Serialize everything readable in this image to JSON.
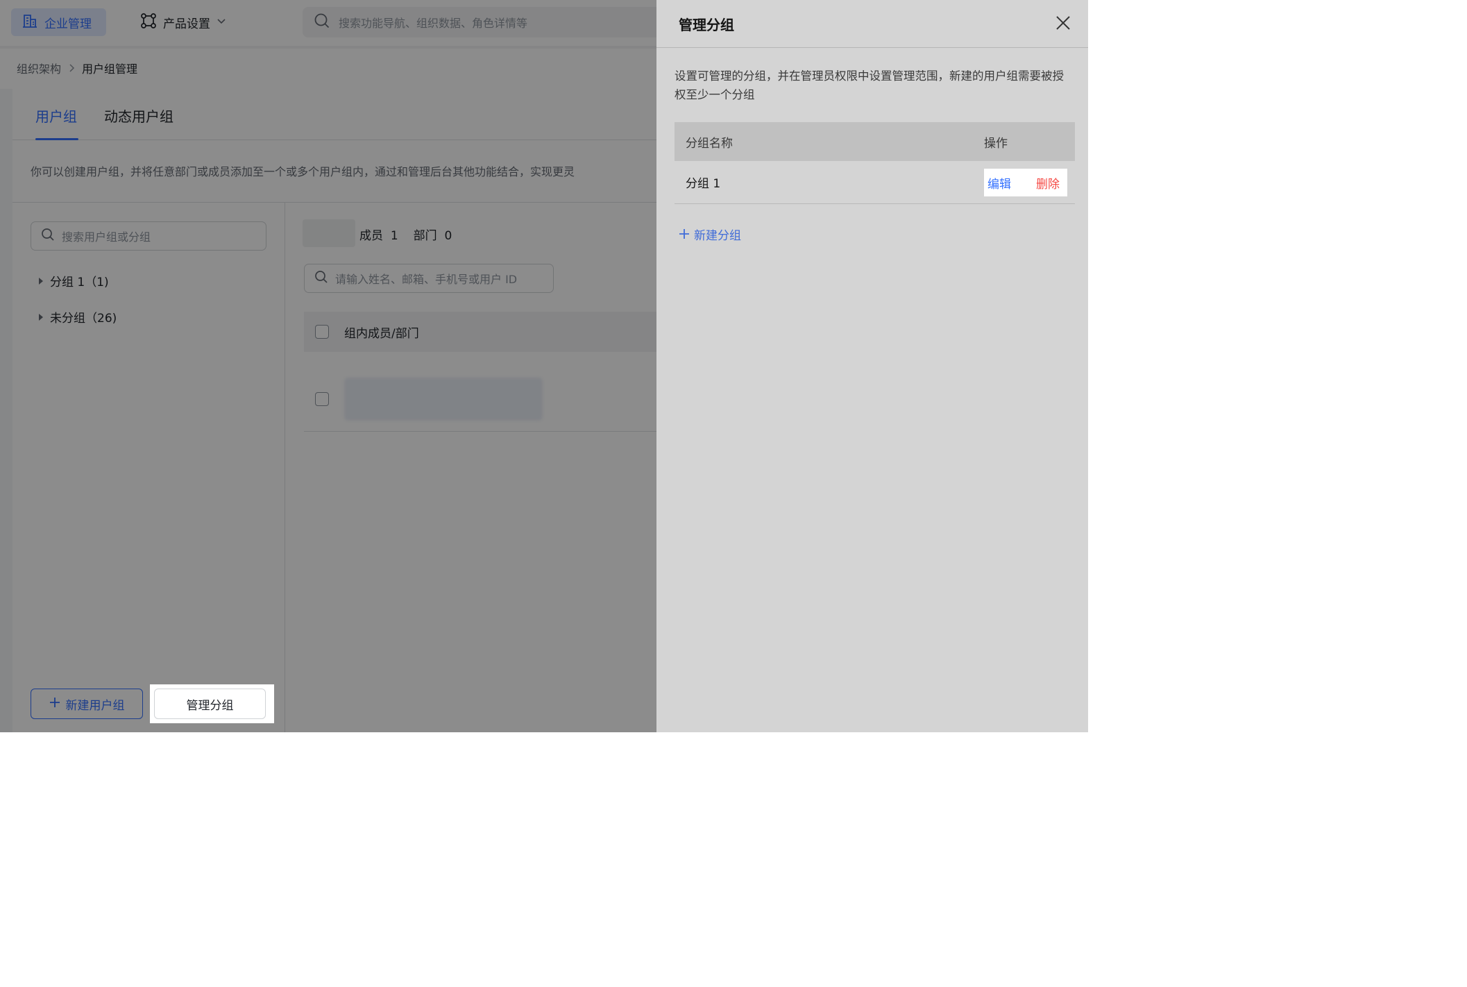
{
  "nav": {
    "enterprise_label": "企业管理",
    "product_label": "产品设置",
    "search_placeholder": "搜索功能导航、组织数据、角色详情等"
  },
  "breadcrumb": {
    "parent": "组织架构",
    "current": "用户组管理"
  },
  "tabs": [
    {
      "label": "用户组",
      "active": true
    },
    {
      "label": "动态用户组",
      "active": false
    }
  ],
  "description": "你可以创建用户组，并将任意部门或成员添加至一个或多个用户组内，通过和管理后台其他功能结合，实现更灵",
  "left_panel": {
    "search_placeholder": "搜索用户组或分组",
    "groups": [
      {
        "label": "分组 1（1)"
      },
      {
        "label": "未分组（26)"
      }
    ],
    "new_group_button": "新建用户组",
    "manage_group_button": "管理分组"
  },
  "middle_panel": {
    "members_label": "成员",
    "members_count": "1",
    "departments_label": "部门",
    "departments_count": "0",
    "search_placeholder": "请输入姓名、邮箱、手机号或用户 ID",
    "column_header": "组内成员/部门"
  },
  "drawer": {
    "title": "管理分组",
    "description": "设置可管理的分组，并在管理员权限中设置管理范围，新建的用户组需要被授权至少一个分组",
    "table": {
      "col_name": "分组名称",
      "col_action": "操作",
      "rows": [
        {
          "name": "分组 1",
          "edit": "编辑",
          "delete": "删除"
        }
      ]
    },
    "add_label": "新建分组"
  },
  "colors": {
    "accent": "#3370ff",
    "danger": "#f54a45"
  }
}
